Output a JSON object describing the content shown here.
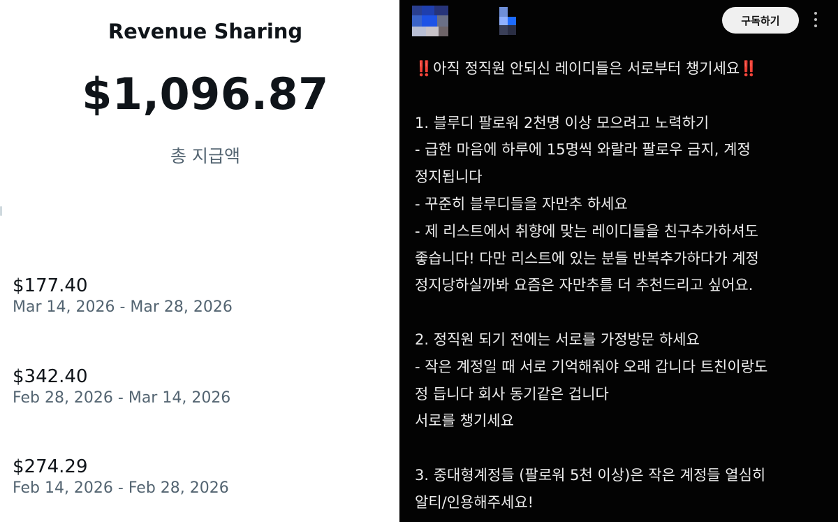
{
  "revenue": {
    "title": "Revenue Sharing",
    "total_amount": "$1,096.87",
    "total_label": "총 지급액",
    "payouts": [
      {
        "amount": "$177.40",
        "range": "Mar 14, 2026 - Mar 28, 2026"
      },
      {
        "amount": "$342.40",
        "range": "Feb 28, 2026 - Mar 14, 2026"
      },
      {
        "amount": "$274.29",
        "range": "Feb 14, 2026 - Feb 28, 2026"
      }
    ]
  },
  "post": {
    "subscribe_label": "구독하기",
    "more_icon": "more-vertical-icon",
    "headline_prefix": "‼️",
    "headline_text": "아직 정직원 안되신 레이디들은 서로부터 챙기세요",
    "headline_suffix": "‼️",
    "lines": [
      "1. 블루디 팔로워 2천명 이상 모으려고 노력하기",
      "- 급한 마음에 하루에 15명씩 와랄라 팔로우 금지, 계정",
      "정지됩니다",
      "- 꾸준히 블루디들을 자만추 하세요",
      "- 제 리스트에서 취향에 맞는 레이디들을 친구추가하셔도",
      "좋습니다! 다만 리스트에 있는 분들 반복추가하다가 계정",
      "정지당하실까봐 요즘은 자만추를 더 추천드리고 싶어요.",
      "",
      "2. 정직원 되기 전에는 서로를 가정방문 하세요",
      "- 작은 계정일 때 서로 기억해줘야 오래 갑니다 트친이랑도",
      "정 듭니다 회사 동기같은 겁니다",
      "서로를 챙기세요",
      "",
      "3. 중대형계정들 (팔로워 5천 이상)은 작은 계정들 열심히",
      "알티/인용해주세요!"
    ]
  },
  "colors": {
    "left_bg": "#ffffff",
    "right_bg": "#030303",
    "primary_text": "#0f1419",
    "secondary_text": "#536471",
    "post_text": "#ececec",
    "accent_red": "#e0245e"
  }
}
